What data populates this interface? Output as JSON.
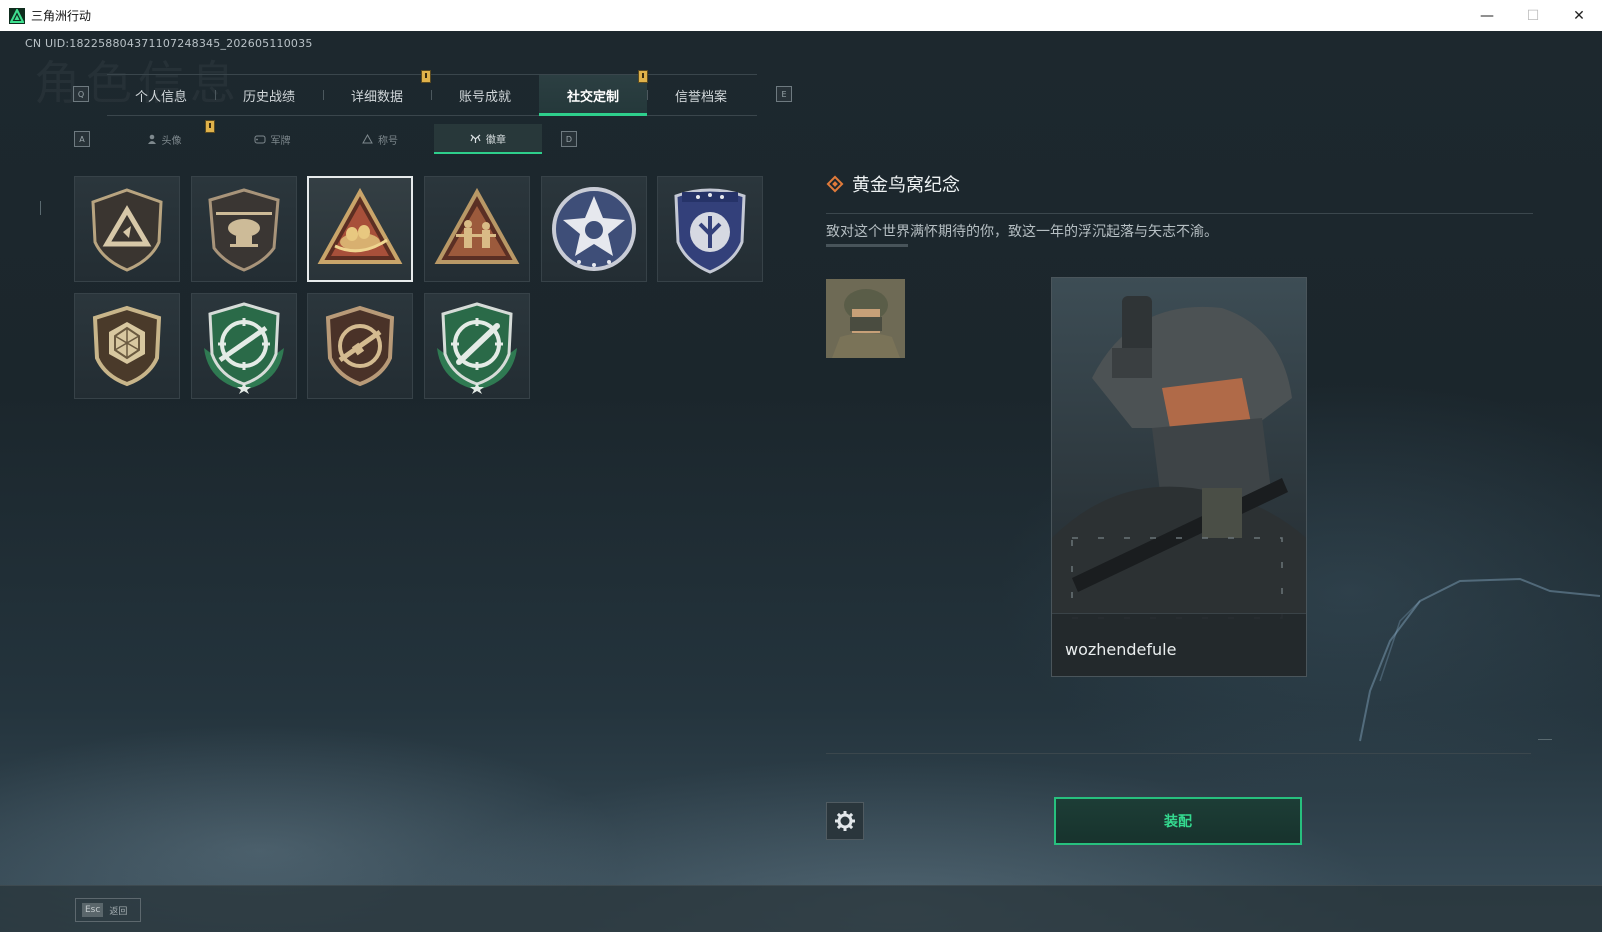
{
  "window": {
    "title": "三角洲行动",
    "minimize_icon": "minimize-icon",
    "maximize_icon": "maximize-icon",
    "close_icon": "close-icon"
  },
  "uid": "CN UID:18225880437110724834­5_202605110035",
  "main_tabs": {
    "prev_key": "Q",
    "next_key": "E",
    "items": [
      {
        "label": "个人信息"
      },
      {
        "label": "历史战绩"
      },
      {
        "label": "详细数据"
      },
      {
        "label": "账号成就"
      },
      {
        "label": "社交定制",
        "active": true
      },
      {
        "label": "信誉档案"
      }
    ]
  },
  "sub_tabs": {
    "prev_key": "A",
    "next_key": "D",
    "items": [
      {
        "label": "头像",
        "icon": "person-icon"
      },
      {
        "label": "军牌",
        "icon": "dogtag-icon"
      },
      {
        "label": "称号",
        "icon": "title-icon"
      },
      {
        "label": "徽章",
        "icon": "badge-icon",
        "active": true
      }
    ]
  },
  "badges": [
    {
      "name": "triangle-shield-badge"
    },
    {
      "name": "helicopter-badge"
    },
    {
      "name": "golden-bird-nest-badge",
      "selected": true
    },
    {
      "name": "soldiers-triangle-badge"
    },
    {
      "name": "star-medal-badge"
    },
    {
      "name": "blue-shield-badge"
    },
    {
      "name": "hexagon-gem-badge"
    },
    {
      "name": "green-sniper-badge"
    },
    {
      "name": "bronze-rifle-badge"
    },
    {
      "name": "green-knife-badge"
    }
  ],
  "detail": {
    "title": "黄金鸟窝纪念",
    "description": "致对这个世界满怀期待的你，致这一年的浮沉起落与矢志不渝。",
    "player_name": "wozhendefule",
    "equip_label": "装配"
  },
  "footer": {
    "esc_key": "Esc",
    "back_label": "返回"
  },
  "colors": {
    "accent_green": "#2ecf8c",
    "notification_yellow": "#e0b24a"
  }
}
